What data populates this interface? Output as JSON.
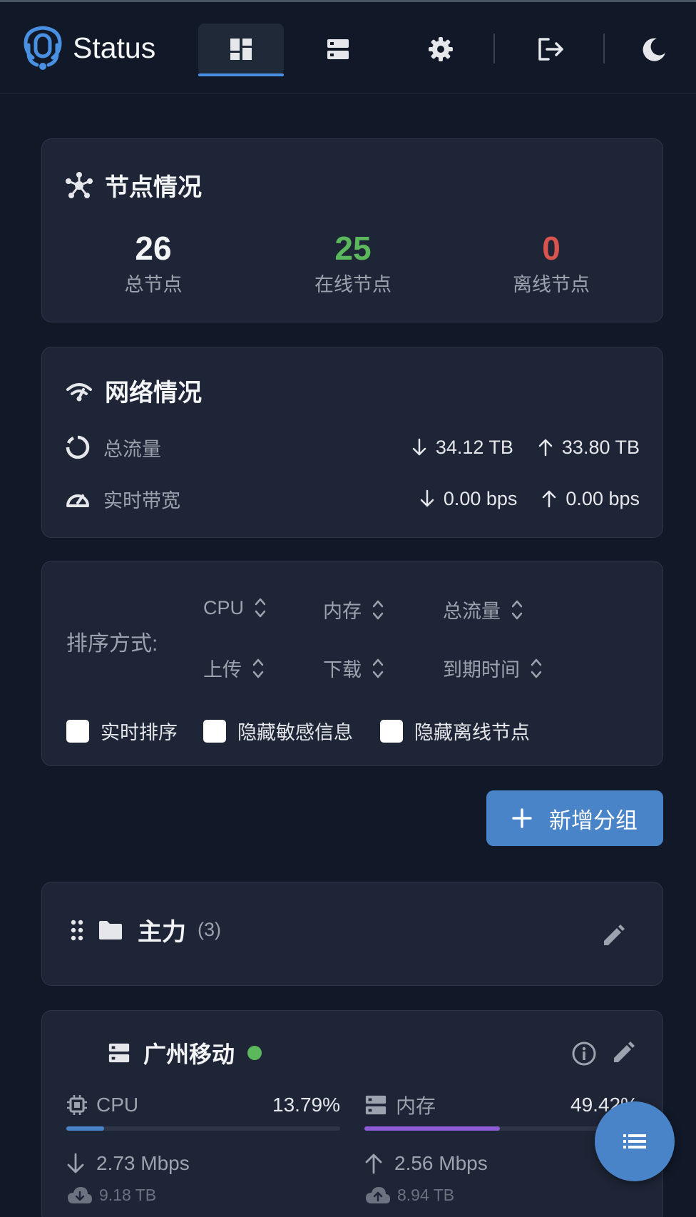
{
  "header": {
    "title": "Status",
    "nav": [
      {
        "name": "dashboard",
        "icon": "dashboard-icon",
        "active": true
      },
      {
        "name": "servers",
        "icon": "server-icon",
        "active": false
      },
      {
        "name": "settings",
        "icon": "gear-icon",
        "active": false
      },
      {
        "name": "logout",
        "icon": "logout-icon",
        "active": false
      },
      {
        "name": "theme",
        "icon": "moon-icon",
        "active": false
      }
    ]
  },
  "nodes": {
    "title": "节点情况",
    "icon": "network-nodes-icon",
    "total": {
      "value": "26",
      "label": "总节点"
    },
    "online": {
      "value": "25",
      "label": "在线节点"
    },
    "offline": {
      "value": "0",
      "label": "离线节点"
    },
    "colors": {
      "online": "#5cb85c",
      "offline": "#d9534f"
    }
  },
  "network": {
    "title": "网络情况",
    "icon": "wifi-icon",
    "traffic": {
      "label": "总流量",
      "down": "34.12 TB",
      "up": "33.80 TB"
    },
    "bandwidth": {
      "label": "实时带宽",
      "down": "0.00 bps",
      "up": "0.00 bps"
    }
  },
  "sort": {
    "label": "排序方式:",
    "options": [
      "CPU",
      "内存",
      "总流量",
      "上传",
      "下载",
      "到期时间"
    ],
    "checks": [
      "实时排序",
      "隐藏敏感信息",
      "隐藏离线节点"
    ]
  },
  "add_group": {
    "label": "新增分组"
  },
  "group": {
    "name": "主力",
    "count": "(3)"
  },
  "server": {
    "name": "广州移动",
    "online": true,
    "cpu": {
      "label": "CPU",
      "value": "13.79%",
      "percent": 13.79,
      "color": "#4a84c8"
    },
    "mem": {
      "label": "内存",
      "value": "49.42%",
      "percent": 49.42,
      "color": "#8e5bd6"
    },
    "down_speed": "2.73 Mbps",
    "up_speed": "2.56 Mbps",
    "down_total": "9.18 TB",
    "up_total": "8.94 TB"
  }
}
